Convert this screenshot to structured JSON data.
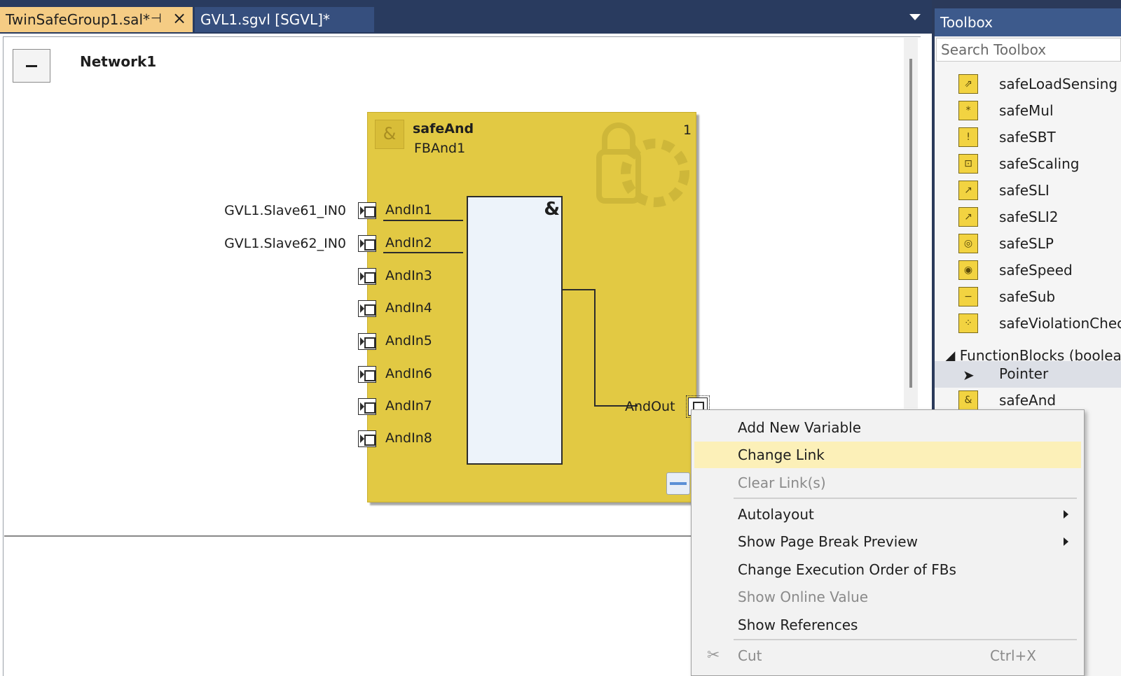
{
  "tabs": {
    "active": {
      "label": "TwinSafeGroup1.sal*"
    },
    "inactive": {
      "label": "GVL1.sgvl [SGVL]*"
    }
  },
  "network": {
    "title": "Network1"
  },
  "block": {
    "type": "safeAnd",
    "instance": "FBAnd1",
    "order": "1",
    "inputs": [
      "AndIn1",
      "AndIn2",
      "AndIn3",
      "AndIn4",
      "AndIn5",
      "AndIn6",
      "AndIn7",
      "AndIn8"
    ],
    "output": "AndOut",
    "symbol": "&"
  },
  "variables": {
    "in1": "GVL1.Slave61_IN0",
    "in2": "GVL1.Slave62_IN0"
  },
  "toolbox": {
    "title": "Toolbox",
    "search_placeholder": "Search Toolbox",
    "items": [
      "safeLoadSensing",
      "safeMul",
      "safeSBT",
      "safeScaling",
      "safeSLI",
      "safeSLI2",
      "safeSLP",
      "safeSpeed",
      "safeSub",
      "safeViolationCheck"
    ],
    "group": "FunctionBlocks (boolean)",
    "pointer": "Pointer",
    "group_items": [
      "safeAnd"
    ]
  },
  "context_menu": {
    "add_new_variable": "Add New Variable",
    "change_link": "Change Link",
    "clear_links": "Clear Link(s)",
    "autolayout": "Autolayout",
    "show_page_break_preview": "Show Page Break Preview",
    "change_execution_order": "Change Execution Order of FBs",
    "show_online_value": "Show Online Value",
    "show_references": "Show References",
    "cut": "Cut",
    "cut_shortcut": "Ctrl+X"
  },
  "colors": {
    "tab_active": "#f5cc84",
    "block_fill": "#e2c943",
    "menu_highlight": "#fcf0b8",
    "toolbox_header": "#3d5a8c"
  }
}
